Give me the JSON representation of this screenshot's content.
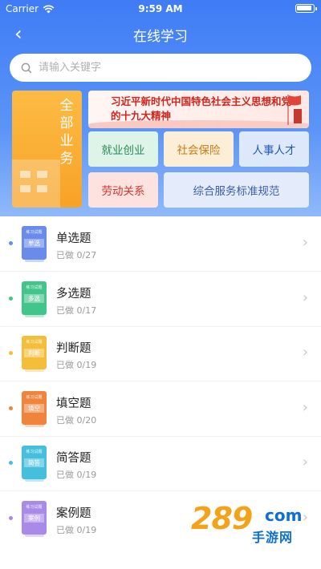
{
  "status": {
    "carrier": "Carrier",
    "time": "9:59 AM"
  },
  "nav": {
    "back_icon": "‹",
    "title": "在线学习"
  },
  "search": {
    "placeholder": "请输入关键字"
  },
  "all_business": {
    "label": "全部业务"
  },
  "banner": {
    "text": "习近平新时代中国特色社会主义思想和党的十九大精神"
  },
  "categories": [
    {
      "label": "就业创业",
      "color": "#2a8a55",
      "bg": "#dff4e8"
    },
    {
      "label": "社会保险",
      "color": "#c87a10",
      "bg": "#fdeed8"
    },
    {
      "label": "人事人才",
      "color": "#2358b8",
      "bg": "#dde9fb"
    },
    {
      "label": "劳动关系",
      "color": "#d0362a",
      "bg": "#fde2df"
    },
    {
      "label": "综合服务标准规范",
      "color": "#3b5fa8",
      "bg": "#e4ecfb"
    }
  ],
  "question_types": [
    {
      "name": "单选题",
      "progress": "已做 0/27",
      "tag": "单选",
      "book_header": "练习试题",
      "color": "#6a8bea"
    },
    {
      "name": "多选题",
      "progress": "已做 0/17",
      "tag": "多选",
      "book_header": "练习试题",
      "color": "#43c48a"
    },
    {
      "name": "判断题",
      "progress": "已做 0/19",
      "tag": "判断",
      "book_header": "练习试题",
      "color": "#f4bd3a"
    },
    {
      "name": "填空题",
      "progress": "已做 0/20",
      "tag": "填空",
      "book_header": "练习试题",
      "color": "#f0843c"
    },
    {
      "name": "简答题",
      "progress": "已做 0/19",
      "tag": "简答",
      "book_header": "练习试题",
      "color": "#45bfdc"
    },
    {
      "name": "案例题",
      "progress": "已做 0/19",
      "tag": "案例",
      "book_header": "练习试题",
      "color": "#a98ae8"
    }
  ],
  "chevron": "›",
  "watermark": {
    "number": "289",
    "domain": "com",
    "subtitle": "手游网"
  }
}
